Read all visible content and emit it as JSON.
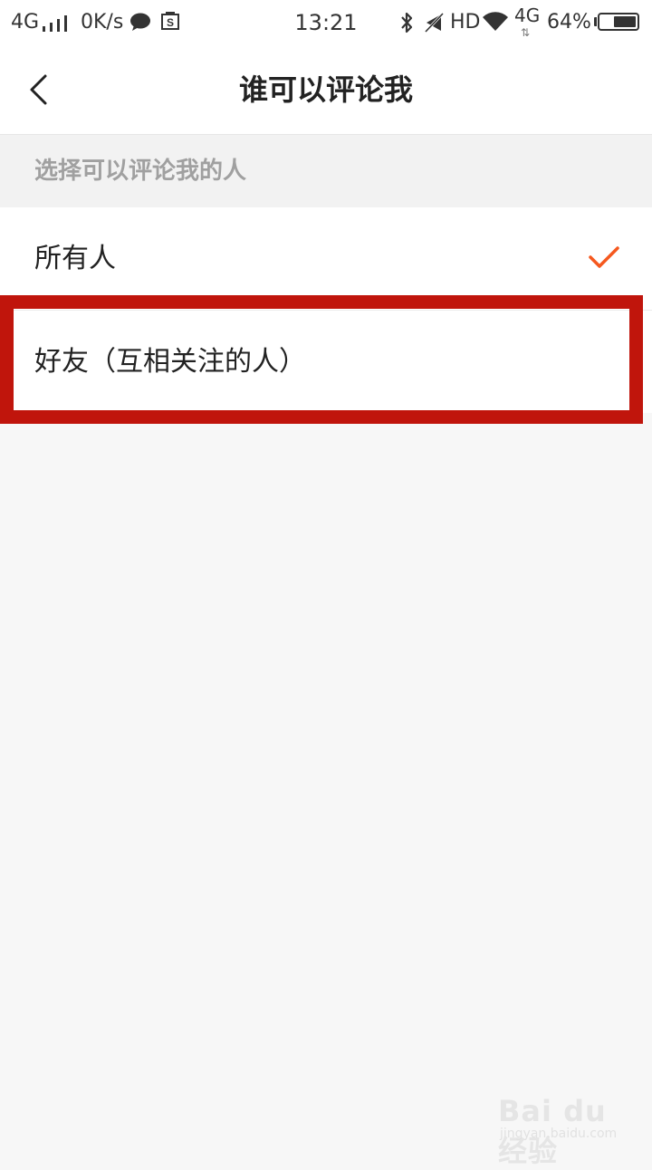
{
  "status_bar": {
    "network": "4G",
    "speed": "0K/s",
    "time": "13:21",
    "hd": "HD",
    "data_network": "4G",
    "battery_percent": "64%",
    "battery_level": 0.64
  },
  "navbar": {
    "title": "谁可以评论我"
  },
  "section": {
    "label": "选择可以评论我的人"
  },
  "options": [
    {
      "label": "所有人",
      "selected": true
    },
    {
      "label": "好友（互相关注的人）",
      "selected": false
    }
  ],
  "colors": {
    "accent": "#f5581e",
    "highlight": "#c0150c"
  },
  "watermark": {
    "logo": "Bai du 经验",
    "sub": "jingyan.baidu.com"
  }
}
